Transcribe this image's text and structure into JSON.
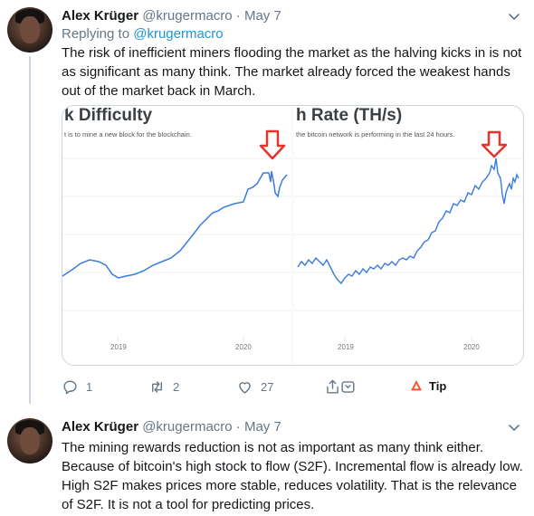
{
  "tweets": [
    {
      "name": "Alex Krüger",
      "handle": "@krugermacro",
      "separator": "·",
      "date": "May 7",
      "replying_to_label": "Replying to",
      "replying_to_handle": "@krugermacro",
      "text": "The risk of inefficient miners flooding the market as the halving kicks in is not as significant as many think. The market already forced the weakest hands out of the market back in March.",
      "actions": {
        "reply_count": "1",
        "retweet_count": "2",
        "like_count": "27",
        "tip_label": "Tip"
      }
    },
    {
      "name": "Alex Krüger",
      "handle": "@krugermacro",
      "separator": "·",
      "date": "May 7",
      "text": "The mining rewards reduction is not as important as many think either. Because of bitcoin's high stock to flow (S2F). Incremental flow is already low. High S2F makes prices more stable, reduces volatility. That is the relevance of S2F. It is not a tool for predicting prices."
    }
  ],
  "media": {
    "chart_left": {
      "title": "k Difficulty",
      "subtitle": "t is to mine a new block for the blockchain.",
      "xticks": [
        "2019",
        "2020"
      ],
      "line_color": "#3a7be0",
      "arrow_color": "#e8332a"
    },
    "chart_right": {
      "title": "h Rate (TH/s)",
      "subtitle": "the bitcoin network is performing in the last 24 hours.",
      "xticks": [
        "2019",
        "2020"
      ],
      "line_color": "#3a7be0",
      "arrow_color": "#e8332a"
    }
  }
}
